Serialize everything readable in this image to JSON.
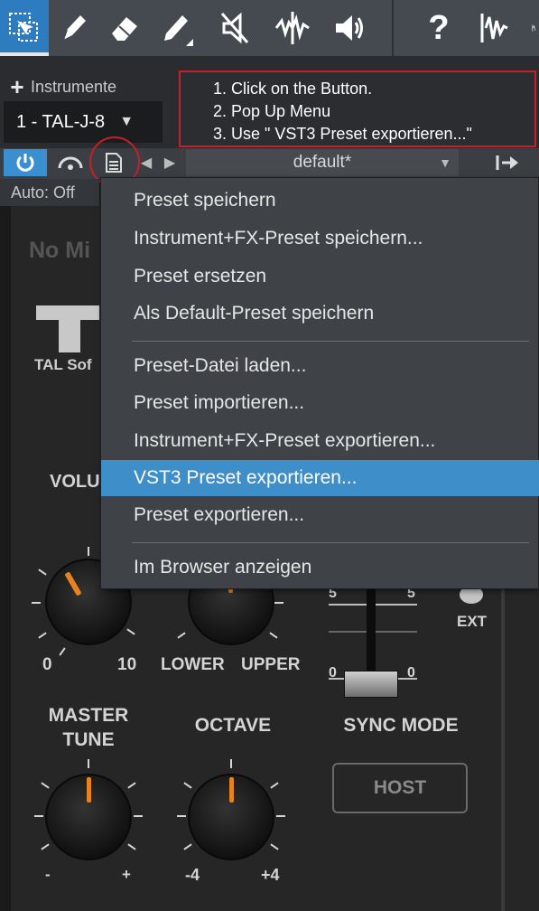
{
  "toolbar": {
    "tools": [
      {
        "icon": "selection-tool-icon"
      },
      {
        "icon": "pen-icon"
      },
      {
        "icon": "eraser-icon"
      },
      {
        "icon": "pencil-icon"
      },
      {
        "icon": "mute-tool-icon"
      },
      {
        "icon": "split-tool-icon"
      },
      {
        "icon": "listen-tool-icon"
      },
      {
        "icon": "help-icon",
        "label": "?"
      },
      {
        "icon": "audio-bend-icon"
      },
      {
        "icon": "audio-bend-icon-2"
      }
    ]
  },
  "instrument": {
    "section_label": "Instrumente",
    "selected": "1 - TAL-J-8"
  },
  "note": {
    "lines": [
      "1. Click on the Button.",
      "2. Pop Up Menu",
      "3. Use \" VST3 Preset exportieren...\""
    ]
  },
  "preset_bar": {
    "preset_name": "default*",
    "auto_label": "Auto: Off"
  },
  "plugin": {
    "no_midi_label": "No Mi",
    "brand": "TAL Sof",
    "volume_label": "VOLU",
    "volume_min": "0",
    "volume_max": "10",
    "lower_label": "LOWER",
    "upper_label": "UPPER",
    "slider_top_left": "5",
    "slider_top_right": "5",
    "slider_bottom_left": "0",
    "slider_bottom_right": "0",
    "ext_label": "EXT",
    "master_tune_line1": "MASTER",
    "master_tune_line2": "TUNE",
    "master_tune_min": "-",
    "master_tune_max": "+",
    "octave_label": "OCTAVE",
    "octave_min": "-4",
    "octave_max": "+4",
    "sync_mode_label": "SYNC MODE",
    "host_button": "HOST"
  },
  "menu": {
    "items": [
      "Preset speichern",
      "Instrument+FX-Preset speichern...",
      "Preset ersetzen",
      "Als Default-Preset speichern",
      "Preset-Datei laden...",
      "Preset importieren...",
      "Instrument+FX-Preset exportieren...",
      "VST3 Preset exportieren...",
      "Preset exportieren...",
      "Im Browser anzeigen"
    ],
    "selected_index": 7
  },
  "colors": {
    "accent": "#3d8ec9",
    "highlight_red": "#c4202a",
    "knob_indicator": "#e8821e"
  }
}
